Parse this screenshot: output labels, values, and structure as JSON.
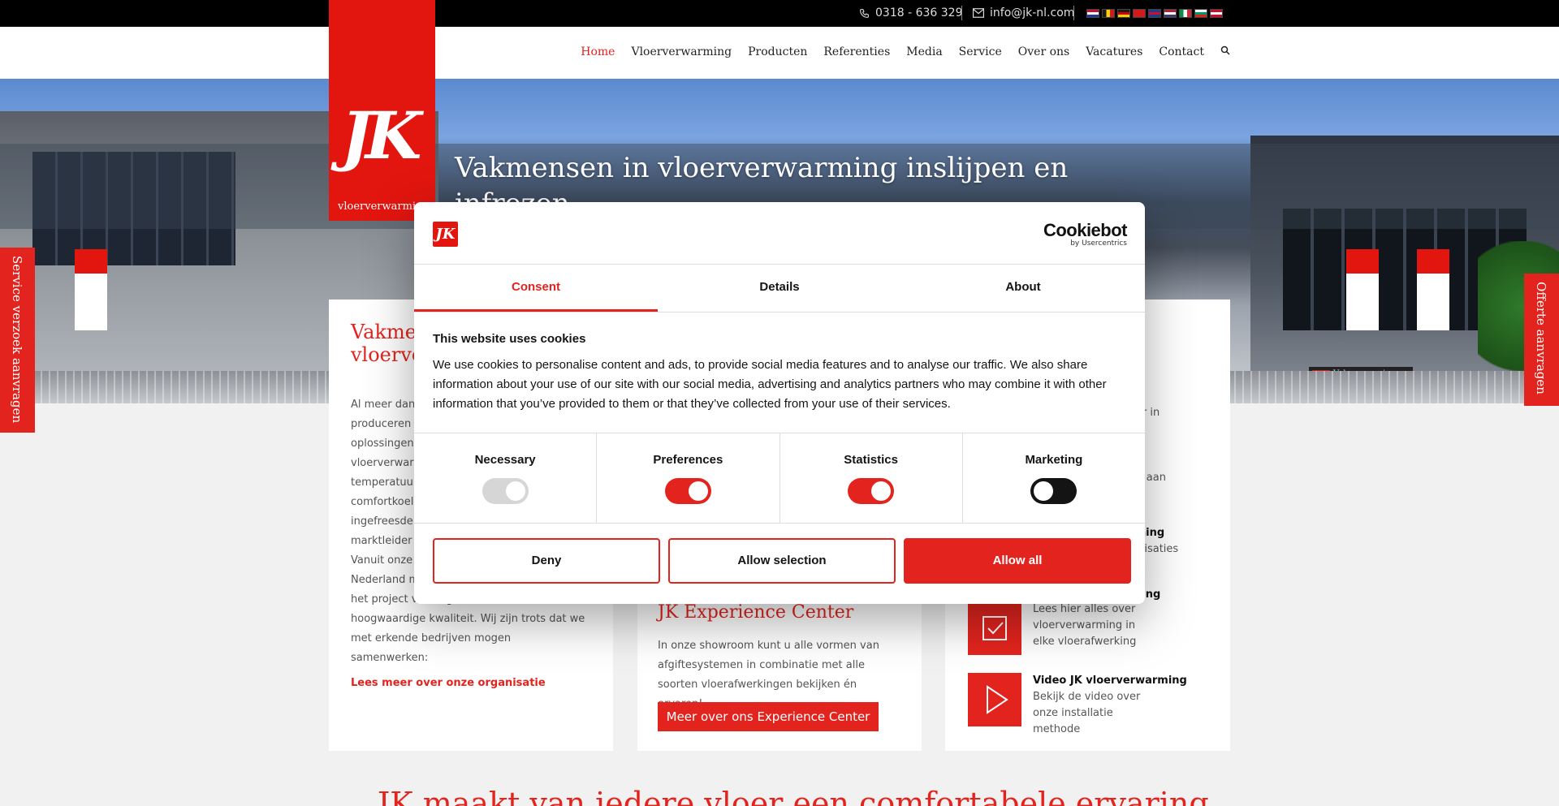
{
  "topbar": {
    "phone": "0318 - 636 329",
    "email": "info@jk-nl.com",
    "flags": [
      {
        "name": "flag-nl",
        "c1": "#c8102e",
        "c2": "#ffffff",
        "c3": "#1d3e8c",
        "dir": "h"
      },
      {
        "name": "flag-be",
        "c1": "#1a1a1a",
        "c2": "#f5d30f",
        "c3": "#d21a1a",
        "dir": "v"
      },
      {
        "name": "flag-de",
        "c1": "#1a1a1a",
        "c2": "#d00000",
        "c3": "#ffcc00",
        "dir": "h"
      },
      {
        "name": "flag-tr",
        "c1": "#d21a1a",
        "c2": "#d21a1a",
        "c3": "#d21a1a",
        "dir": "h"
      },
      {
        "name": "flag-gb",
        "c1": "#1d3e8c",
        "c2": "#c8102e",
        "c3": "#1d3e8c",
        "dir": "h"
      },
      {
        "name": "flag-us",
        "c1": "#b22234",
        "c2": "#ffffff",
        "c3": "#3c3b6e",
        "dir": "h"
      },
      {
        "name": "flag-it",
        "c1": "#009246",
        "c2": "#ffffff",
        "c3": "#ce2b37",
        "dir": "v"
      },
      {
        "name": "flag-bg",
        "c1": "#ffffff",
        "c2": "#00966e",
        "c3": "#d62612",
        "dir": "h"
      },
      {
        "name": "flag-dk",
        "c1": "#c8102e",
        "c2": "#ffffff",
        "c3": "#c8102e",
        "dir": "h"
      }
    ]
  },
  "logo": {
    "mark": "JK",
    "tagline": "vloerverwarming"
  },
  "nav": {
    "items": [
      "Home",
      "Vloerverwarming",
      "Producten",
      "Referenties",
      "Media",
      "Service",
      "Over ons",
      "Vacatures",
      "Contact"
    ],
    "search_icon": "search-icon"
  },
  "hero": {
    "title": "Vakmensen in vloerverwarming inslijpen en infrezen"
  },
  "side_tabs": {
    "left": "Service verzoek aanvragen",
    "right": "Offerte aanvragen"
  },
  "card1": {
    "heading": "Vakmensen in vloerverwarming",
    "text": "Al meer dan 30 jaar zijn wij specialist in het produceren en installeren van innovatieve oplossingen op het gebied van vloerverwarming, lage temperatuursverwarming en comfortkoeling. Wij zijn leverancier van ingefreesde vloerverwarming en marktleider in ingeslepen vloerverwarming. Vanuit onze vestiging werken we door heel Nederland met gespecialiseerde teams die het project volledig en leveren een hoogwaardige kwaliteit. Wij zijn trots dat we met erkende bedrijven mogen samenwerken:",
    "link": "Lees meer over onze organisatie"
  },
  "card2": {
    "heading": "JK Experience Center",
    "text": "In onze showroom kunt u alle vormen van afgiftesystemen in combinatie met alle soorten vloerafwerkingen bekijken én ervaren!",
    "button": "Meer over ons Experience Center"
  },
  "card3": {
    "frag1": "gurator in",
    "frag2": "erzoek aan",
    "frag3_title": "rwarming",
    "frag3_text": "specialisaties",
    "frag4_title": "rwerking",
    "rows": [
      {
        "title": "Vloerafwerking",
        "desc": "Lees hier alles over vloerverwarming in elke vloerafwerking"
      },
      {
        "title": "Video JK vloerverwarming",
        "desc": "Bekijk de video over onze installatie methode"
      }
    ]
  },
  "bottom_title": "JK maakt van iedere vloer een comfortabele ervaring",
  "cookie": {
    "provider_bold": "Cookiebot",
    "provider_sub": "by Usercentrics",
    "tabs": [
      "Consent",
      "Details",
      "About"
    ],
    "title": "This website uses cookies",
    "text": "We use cookies to personalise content and ads, to provide social media features and to analyse our traffic. We also share information about your use of our site with our social media, advertising and analytics partners who may combine it with other information that you’ve provided to them or that they’ve collected from your use of their services.",
    "toggles": [
      {
        "label": "Necessary",
        "state": "disabled-on"
      },
      {
        "label": "Preferences",
        "state": "on"
      },
      {
        "label": "Statistics",
        "state": "on"
      },
      {
        "label": "Marketing",
        "state": "off"
      }
    ],
    "buttons": {
      "deny": "Deny",
      "allow_selection": "Allow selection",
      "allow_all": "Allow all"
    }
  },
  "colors": {
    "brand_red": "#e3241e",
    "logo_red": "#e3150f",
    "dark": "#141414"
  }
}
